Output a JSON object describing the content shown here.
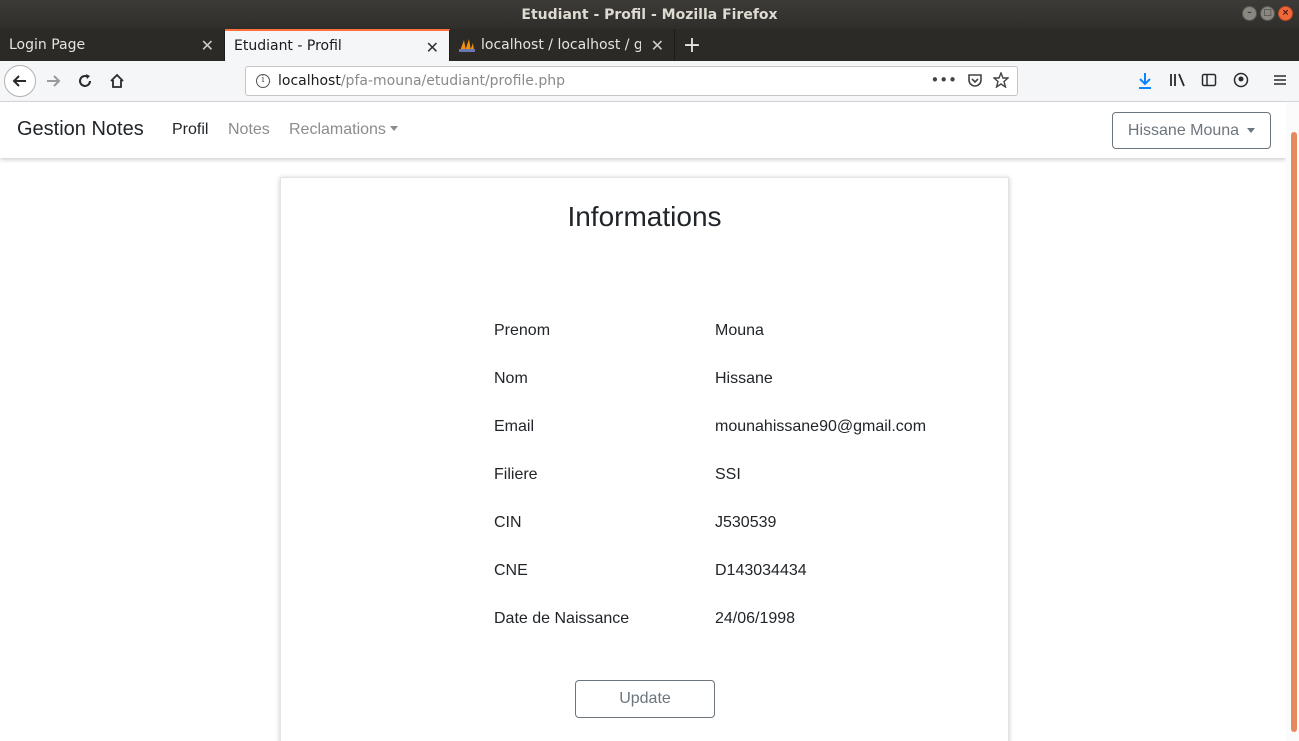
{
  "window": {
    "title": "Etudiant - Profil - Mozilla Firefox"
  },
  "tabs": [
    {
      "label": "Login Page",
      "active": false
    },
    {
      "label": "Etudiant - Profil",
      "active": true
    },
    {
      "label": "localhost / localhost / ge",
      "active": false,
      "icon": "phpmyadmin-icon"
    }
  ],
  "urlbar": {
    "host": "localhost",
    "path": "/pfa-mouna/etudiant/profile.php"
  },
  "app": {
    "brand": "Gestion Notes",
    "nav": {
      "profil": "Profil",
      "notes": "Notes",
      "reclamations": "Reclamations"
    },
    "user_menu": "Hissane Mouna"
  },
  "card": {
    "title": "Informations",
    "rows": [
      {
        "label": "Prenom",
        "value": "Mouna"
      },
      {
        "label": "Nom",
        "value": "Hissane"
      },
      {
        "label": "Email",
        "value": "mounahissane90@gmail.com"
      },
      {
        "label": "Filiere",
        "value": "SSI"
      },
      {
        "label": "CIN",
        "value": "J530539"
      },
      {
        "label": "CNE",
        "value": "D143034434"
      },
      {
        "label": "Date de Naissance",
        "value": "24/06/1998"
      }
    ],
    "update_label": "Update"
  },
  "colors": {
    "accent_tab": "#ff7139",
    "scroll_thumb": "#e6895d",
    "secondary": "#6c757d"
  }
}
